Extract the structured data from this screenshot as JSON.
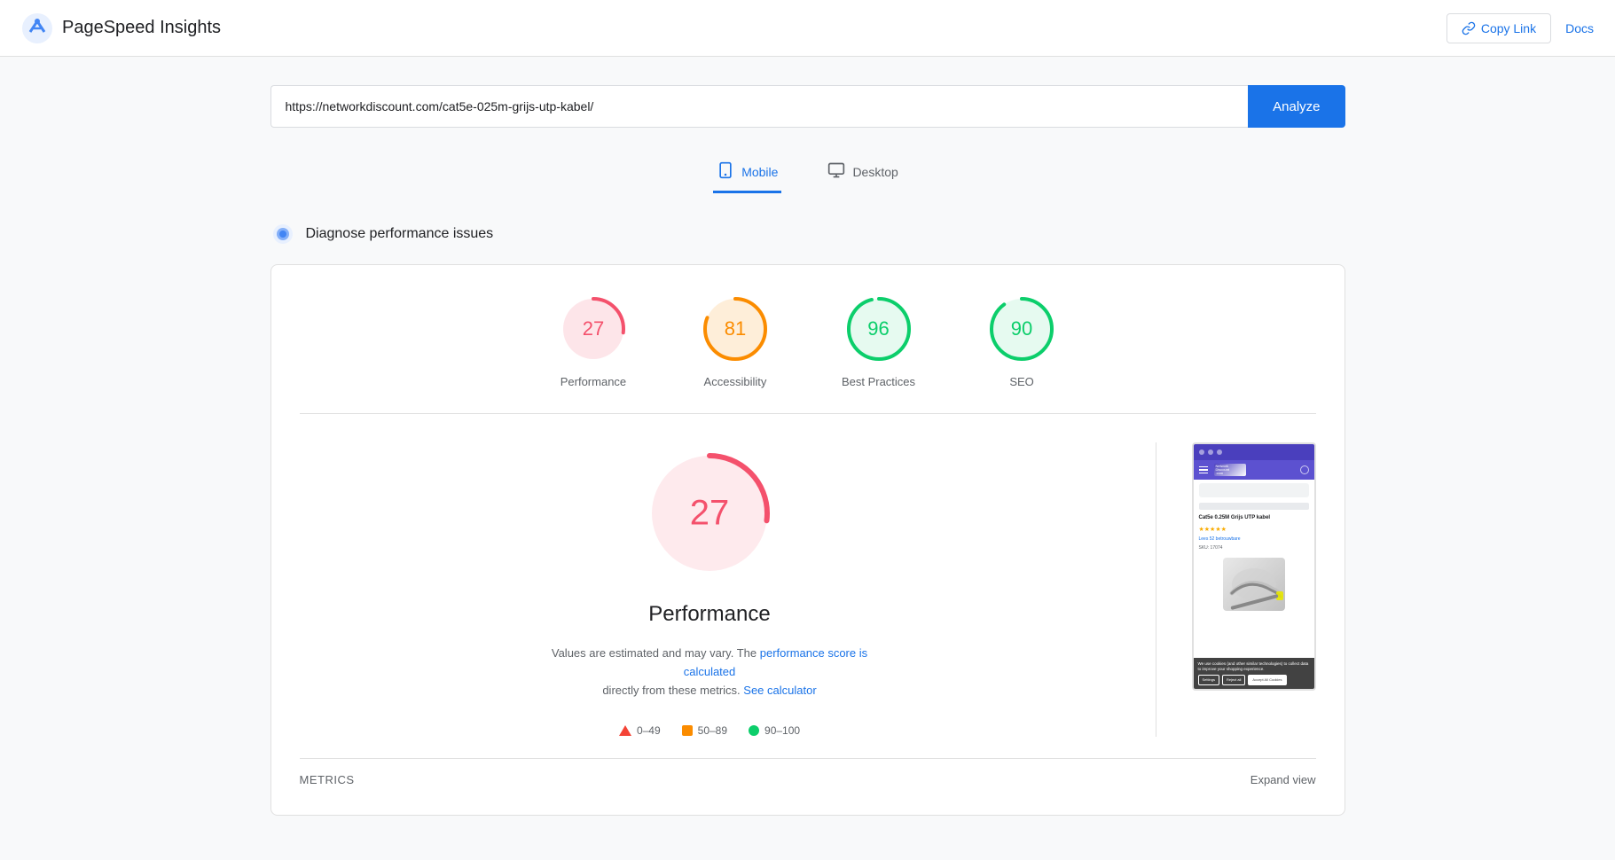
{
  "header": {
    "app_name": "PageSpeed Insights",
    "copy_link_label": "Copy Link",
    "docs_label": "Docs"
  },
  "search": {
    "url_value": "https://networkdiscount.com/cat5e-025m-grijs-utp-kabel/",
    "analyze_label": "Analyze"
  },
  "tabs": [
    {
      "id": "mobile",
      "label": "Mobile",
      "active": true
    },
    {
      "id": "desktop",
      "label": "Desktop",
      "active": false
    }
  ],
  "section": {
    "title": "Diagnose performance issues"
  },
  "scores": [
    {
      "id": "performance",
      "value": 27,
      "label": "Performance",
      "color": "#f4516c",
      "bg": "#f4516c",
      "percent": 27
    },
    {
      "id": "accessibility",
      "value": 81,
      "label": "Accessibility",
      "color": "#fb8c00",
      "bg": "#fb8c00",
      "percent": 81
    },
    {
      "id": "best-practices",
      "value": 96,
      "label": "Best Practices",
      "color": "#0cce6b",
      "bg": "#0cce6b",
      "percent": 96
    },
    {
      "id": "seo",
      "value": 90,
      "label": "SEO",
      "color": "#0cce6b",
      "bg": "#0cce6b",
      "percent": 90
    }
  ],
  "performance_detail": {
    "score": "27",
    "title": "Performance",
    "description_prefix": "Values are estimated and may vary. The",
    "link1_label": "performance score is calculated",
    "description_mid": "directly from these metrics.",
    "link2_label": "See calculator",
    "legend": [
      {
        "id": "red",
        "range": "0–49",
        "type": "triangle",
        "color": "#f44336"
      },
      {
        "id": "orange",
        "range": "50–89",
        "type": "square",
        "color": "#fb8c00"
      },
      {
        "id": "green",
        "range": "90–100",
        "type": "circle",
        "color": "#0cce6b"
      }
    ]
  },
  "screenshot": {
    "title": "Cat5e 0.25M Grijs UTP kabel",
    "stars": "★★★★★",
    "reviews": "Lees 52 betrouwbare",
    "sku": "SKU: 17074",
    "cookie_text": "We use cookies (and other similar technologies) to collect data to improve your shopping experience.",
    "btn_settings": "Settings",
    "btn_reject": "Reject all",
    "btn_accept": "Accept All Cookies"
  },
  "footer": {
    "metrics_label": "METRICS",
    "expand_label": "Expand view"
  }
}
